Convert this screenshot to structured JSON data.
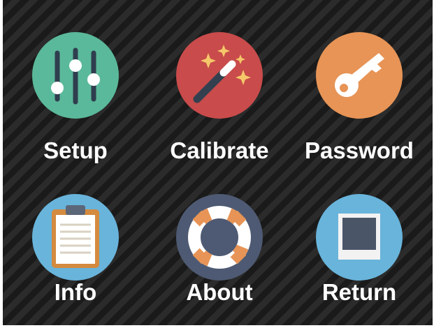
{
  "menu": {
    "items": [
      {
        "id": "setup",
        "label": "Setup",
        "icon": "sliders-icon",
        "color": "#5ab99a"
      },
      {
        "id": "calibrate",
        "label": "Calibrate",
        "icon": "magic-wand-icon",
        "color": "#c94b4b"
      },
      {
        "id": "password",
        "label": "Password",
        "icon": "key-icon",
        "color": "#e79456"
      },
      {
        "id": "info",
        "label": "Info",
        "icon": "clipboard-icon",
        "color": "#68b4db"
      },
      {
        "id": "about",
        "label": "About",
        "icon": "lifebuoy-icon",
        "color": "#4e5a73"
      },
      {
        "id": "return",
        "label": "Return",
        "icon": "return-frame-icon",
        "color": "#68b4db"
      }
    ]
  }
}
